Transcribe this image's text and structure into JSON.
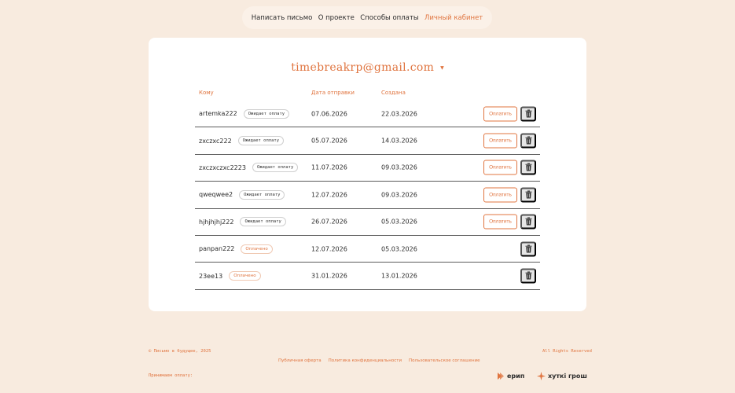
{
  "nav": {
    "items": [
      {
        "label": "Написать письмо",
        "active": false
      },
      {
        "label": "О проекте",
        "active": false
      },
      {
        "label": "Способы оплаты",
        "active": false
      },
      {
        "label": "Личный кабинет",
        "active": true
      }
    ]
  },
  "account": {
    "email": "timebreakrp@gmail.com",
    "caret": "▼"
  },
  "table": {
    "headers": {
      "to": "Кому",
      "sent": "Дата отправки",
      "created": "Создана"
    },
    "pay_label": "Оплатить",
    "rows": [
      {
        "to": "artemka222",
        "status": "Ожидает оплату",
        "paid": false,
        "sent": "07.06.2026",
        "created": "22.03.2026"
      },
      {
        "to": "zxczxc222",
        "status": "Ожидает оплату",
        "paid": false,
        "sent": "05.07.2026",
        "created": "14.03.2026"
      },
      {
        "to": "zxczxczxc2223",
        "status": "Ожидает оплату",
        "paid": false,
        "sent": "11.07.2026",
        "created": "09.03.2026"
      },
      {
        "to": "qweqwee2",
        "status": "Ожидает оплату",
        "paid": false,
        "sent": "12.07.2026",
        "created": "09.03.2026"
      },
      {
        "to": "hjhjhjhj222",
        "status": "Ожидает оплату",
        "paid": false,
        "sent": "26.07.2026",
        "created": "05.03.2026"
      },
      {
        "to": "panpan222",
        "status": "Оплачено",
        "paid": true,
        "sent": "12.07.2026",
        "created": "05.03.2026"
      },
      {
        "to": "23ee13",
        "status": "Оплачено",
        "paid": true,
        "sent": "31.01.2026",
        "created": "13.01.2026"
      }
    ]
  },
  "footer": {
    "copyright": "© Письмо в будущее, 2025",
    "rights": "All Rights Reserved",
    "links": [
      "Публичная оферта",
      "Политика конфиденциальности",
      "Пользовательское соглашение"
    ],
    "accept_payment": "Принимаем оплату:",
    "logos": [
      {
        "name": "ерип"
      },
      {
        "name": "хуткі грош"
      }
    ]
  },
  "colors": {
    "accent": "#e0743f",
    "background": "#f8ebdf",
    "card": "#ffffff"
  }
}
